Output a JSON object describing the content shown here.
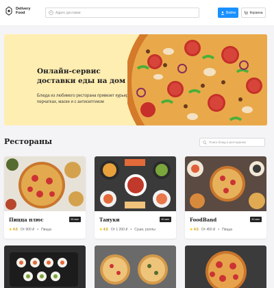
{
  "header": {
    "logo_line1": "Delivery",
    "logo_line2": "Food",
    "search_placeholder": "Адрес доставки",
    "login_label": "Войти",
    "cart_label": "Корзина"
  },
  "promo": {
    "title": "Онлайн-сервис доставки еды на дом",
    "text": "Блюда из любимого ресторана привезет курьер в перчатках, маске и с антисептиком"
  },
  "restaurants": {
    "title": "Рестораны",
    "search_placeholder": "Поиск блюд и ресторанов",
    "items": [
      {
        "name": "Пицца плюс",
        "time": "50 мин",
        "rating": "4.5",
        "price": "От 900 ₽",
        "category": "Пицца"
      },
      {
        "name": "Тануки",
        "time": "60 мин",
        "rating": "4.5",
        "price": "От 1 200 ₽",
        "category": "Суши, роллы"
      },
      {
        "name": "FoodBand",
        "time": "50 мин",
        "rating": "4.5",
        "price": "От 450 ₽",
        "category": "Пицца"
      }
    ]
  },
  "colors": {
    "accent": "#1890ff",
    "promo_bg": "#ffeeb2",
    "star": "#fac800"
  }
}
